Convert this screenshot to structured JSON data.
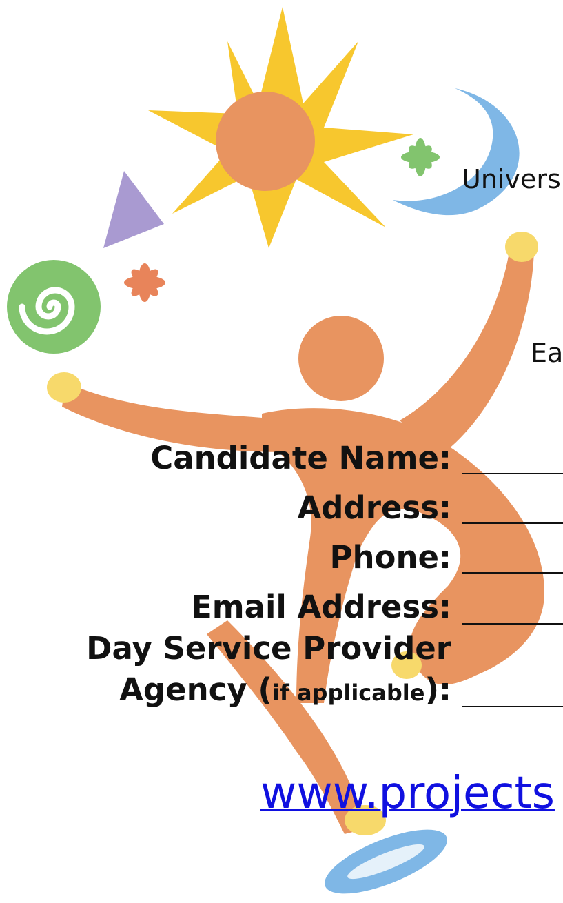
{
  "header": {
    "line1_fragment": "Univers",
    "line2_fragment": "Ea"
  },
  "form": {
    "fields": [
      {
        "label": "Candidate Name:"
      },
      {
        "label": "Address:"
      },
      {
        "label": "Phone:"
      },
      {
        "label": "Email Address:"
      },
      {
        "label_line1": "Day Service Provider",
        "label_line2_main": "Agency (",
        "label_line2_small": "if applicable",
        "label_line2_end": "):"
      }
    ]
  },
  "footer": {
    "url_fragment": "www.projects"
  },
  "colors": {
    "figure_orange": "#E89460",
    "sun_yellow": "#F7C72E",
    "moon_blue": "#7FB7E6",
    "triangle_purple": "#A99AD1",
    "spiral_green": "#82C46E",
    "link_blue": "#1010E0"
  }
}
